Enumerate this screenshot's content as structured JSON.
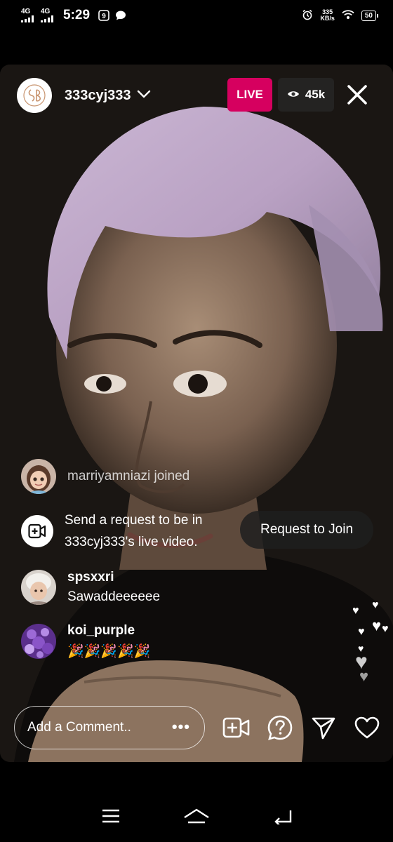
{
  "status_bar": {
    "network_1": "4G",
    "network_2": "4G",
    "time": "5:29",
    "speed_value": "335",
    "speed_unit": "KB/s",
    "battery": "50"
  },
  "header": {
    "username": "333cyj333",
    "live_label": "LIVE",
    "viewer_count": "45k"
  },
  "feed": {
    "join_event": "marriyamniazi joined",
    "request_prompt": "Send a request to be in 333cyj333's live video.",
    "request_button": "Request to Join",
    "comments": [
      {
        "username": "spsxxri",
        "text": "Sawaddeeeeee"
      },
      {
        "username": "koi_purple",
        "text": "🎉🎉🎉🎉🎉"
      }
    ]
  },
  "composer": {
    "placeholder": "Add a Comment..",
    "more_label": "•••"
  },
  "icons": {
    "close": "close-icon",
    "eye": "eye-icon",
    "video_add": "video-add-icon",
    "question": "question-icon",
    "send": "send-icon",
    "like": "heart-icon"
  },
  "colors": {
    "live_badge": "#d6005f",
    "background": "#000000"
  }
}
